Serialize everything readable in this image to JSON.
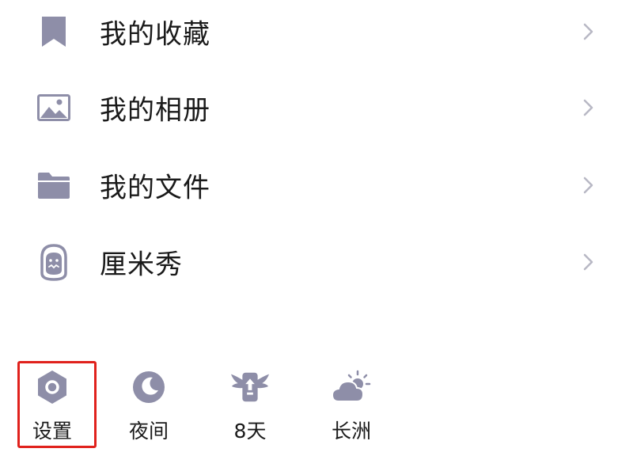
{
  "colors": {
    "icon": "#8e8ea8",
    "text": "#1a1a1a",
    "chevron": "#b8b8c4",
    "highlight": "#e0211c"
  },
  "menu": {
    "items": [
      {
        "label": "我的收藏",
        "icon": "bookmark-icon"
      },
      {
        "label": "我的相册",
        "icon": "image-icon"
      },
      {
        "label": "我的文件",
        "icon": "folder-icon"
      },
      {
        "label": "厘米秀",
        "icon": "avatar-icon"
      }
    ]
  },
  "bottom": {
    "items": [
      {
        "label": "设置",
        "icon": "settings-icon",
        "highlighted": true
      },
      {
        "label": "夜间",
        "icon": "moon-icon"
      },
      {
        "label": "8天",
        "icon": "winged-badge-icon"
      },
      {
        "label": "长洲",
        "icon": "weather-cloud-sun-icon"
      }
    ]
  }
}
